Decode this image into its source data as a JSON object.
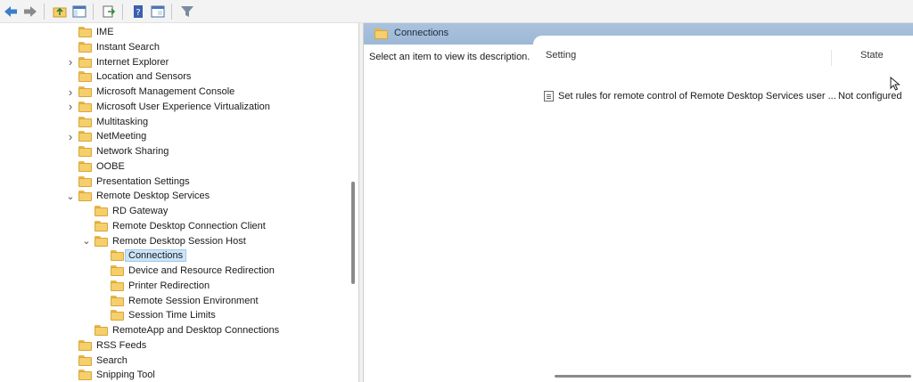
{
  "toolbar": {
    "buttons": [
      {
        "icon": "back-arrow-icon"
      },
      {
        "icon": "forward-arrow-icon"
      },
      {
        "icon": "up-folder-icon"
      },
      {
        "icon": "show-hide-console-tree-icon"
      },
      {
        "icon": "export-list-icon"
      },
      {
        "icon": "help-icon"
      },
      {
        "icon": "properties-view-icon"
      },
      {
        "icon": "filter-icon"
      }
    ]
  },
  "tree": {
    "items": [
      {
        "label": "IME",
        "expander": "",
        "indent": 0
      },
      {
        "label": "Instant Search",
        "expander": "",
        "indent": 0
      },
      {
        "label": "Internet Explorer",
        "expander": "collapsed",
        "indent": 0
      },
      {
        "label": "Location and Sensors",
        "expander": "",
        "indent": 0
      },
      {
        "label": "Microsoft Management Console",
        "expander": "collapsed",
        "indent": 0
      },
      {
        "label": "Microsoft User Experience Virtualization",
        "expander": "collapsed",
        "indent": 0
      },
      {
        "label": "Multitasking",
        "expander": "",
        "indent": 0
      },
      {
        "label": "NetMeeting",
        "expander": "collapsed",
        "indent": 0
      },
      {
        "label": "Network Sharing",
        "expander": "",
        "indent": 0
      },
      {
        "label": "OOBE",
        "expander": "",
        "indent": 0
      },
      {
        "label": "Presentation Settings",
        "expander": "",
        "indent": 0
      },
      {
        "label": "Remote Desktop Services",
        "expander": "expanded",
        "indent": 0
      },
      {
        "label": "RD Gateway",
        "expander": "",
        "indent": 1
      },
      {
        "label": "Remote Desktop Connection Client",
        "expander": "",
        "indent": 1
      },
      {
        "label": "Remote Desktop Session Host",
        "expander": "expanded",
        "indent": 1
      },
      {
        "label": "Connections",
        "expander": "",
        "indent": 2,
        "selected": true
      },
      {
        "label": "Device and Resource Redirection",
        "expander": "",
        "indent": 2
      },
      {
        "label": "Printer Redirection",
        "expander": "",
        "indent": 2
      },
      {
        "label": "Remote Session Environment",
        "expander": "",
        "indent": 2
      },
      {
        "label": "Session Time Limits",
        "expander": "",
        "indent": 2
      },
      {
        "label": "RemoteApp and Desktop Connections",
        "expander": "",
        "indent": 1
      },
      {
        "label": "RSS Feeds",
        "expander": "",
        "indent": 0
      },
      {
        "label": "Search",
        "expander": "",
        "indent": 0
      },
      {
        "label": "Snipping Tool",
        "expander": "",
        "indent": 0
      }
    ]
  },
  "details": {
    "header_title": "Connections",
    "description": "Select an item to view its description.",
    "columns": {
      "setting": "Setting",
      "state": "State"
    },
    "rows": [
      {
        "setting": "Set rules for remote control of Remote Desktop Services user ...",
        "state": "Not configured"
      }
    ]
  },
  "colors": {
    "header_bg": "#9db8d6",
    "folder_yellow": "#f5cf6b",
    "selection_bg": "#cce4f7"
  }
}
